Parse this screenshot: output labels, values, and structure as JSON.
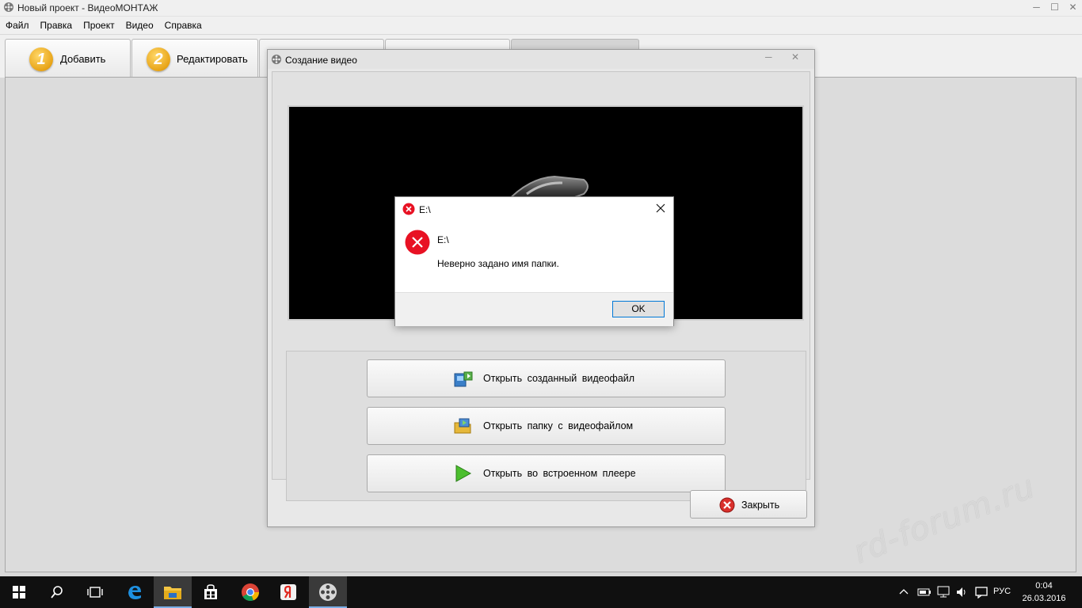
{
  "window": {
    "title": "Новый проект - ВидеоМОНТАЖ"
  },
  "menu": [
    "Файл",
    "Правка",
    "Проект",
    "Видео",
    "Справка"
  ],
  "tabs": [
    {
      "number": "1",
      "label": "Добавить"
    },
    {
      "number": "2",
      "label": "Редактировать"
    }
  ],
  "dialog": {
    "title": "Создание видео",
    "buttons": {
      "open_file": "Открыть  созданный  видеофайл",
      "open_folder": "Открыть  папку  с  видеофайлом",
      "open_player": "Открыть во встроенном плеере"
    },
    "close_label": "Закрыть"
  },
  "message_box": {
    "title": "E:\\",
    "heading": "E:\\",
    "text": "Неверно задано имя папки.",
    "ok_label": "OK"
  },
  "taskbar": {
    "language": "РУС",
    "time": "0:04",
    "date": "26.03.2016"
  },
  "watermark": "rd-forum.ru",
  "colors": {
    "error_red": "#e81123",
    "accent_blue": "#0078d7",
    "taskbar_bg": "#101010"
  }
}
